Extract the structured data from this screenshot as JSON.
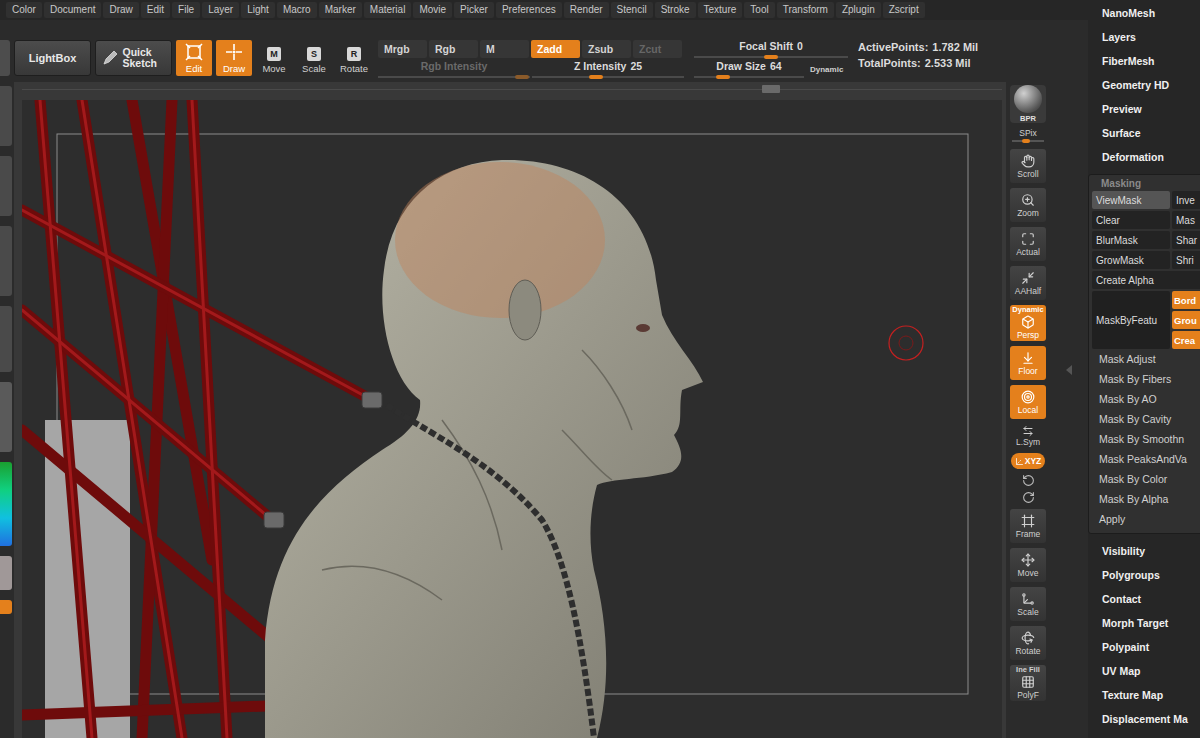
{
  "menu": [
    "Color",
    "Document",
    "Draw",
    "Edit",
    "File",
    "Layer",
    "Light",
    "Macro",
    "Marker",
    "Material",
    "Movie",
    "Picker",
    "Preferences",
    "Render",
    "Stencil",
    "Stroke",
    "Texture",
    "Tool",
    "Transform",
    "Zplugin",
    "Zscript"
  ],
  "toolbar": {
    "lightbox": "LightBox",
    "quickSketch": "Quick Sketch",
    "tools": [
      {
        "label": "Edit",
        "selected": true
      },
      {
        "label": "Draw",
        "selected": true
      },
      {
        "label": "Move",
        "key": "M",
        "selected": false
      },
      {
        "label": "Scale",
        "key": "S",
        "selected": false
      },
      {
        "label": "Rotate",
        "key": "R",
        "selected": false
      }
    ],
    "modes": [
      {
        "label": "Mrgb",
        "selected": false,
        "disabled": false
      },
      {
        "label": "Rgb",
        "selected": false,
        "disabled": false
      },
      {
        "label": "M",
        "selected": false,
        "disabled": false
      },
      {
        "label": "Zadd",
        "selected": true,
        "disabled": false
      },
      {
        "label": "Zsub",
        "selected": false,
        "disabled": false
      },
      {
        "label": "Zcut",
        "selected": false,
        "disabled": true
      }
    ],
    "intensity": [
      {
        "label": "Rgb Intensity",
        "level": 0.95,
        "disabled": true
      },
      {
        "label": "Z Intensity",
        "value": "25",
        "level": 0.42,
        "disabled": false
      }
    ],
    "focal": {
      "label": "Focal Shift",
      "value": "0",
      "level": 0.5,
      "disabled": false
    },
    "drawSize": {
      "label": "Draw Size",
      "value": "64",
      "level": 0.26,
      "disabled": false
    },
    "dynamic": "Dynamic",
    "stats": [
      {
        "label": "ActivePoints:",
        "value": "1.782 Mil"
      },
      {
        "label": "TotalPoints:",
        "value": "2.533 Mil"
      }
    ]
  },
  "canvas": {
    "scroll": 0.755
  },
  "shelf": [
    {
      "label": "BPR",
      "kind": "sphere",
      "selected": false
    },
    {
      "label": "SPix",
      "kind": "slider",
      "level": 0.45,
      "selected": false
    },
    {
      "label": "Scroll",
      "kind": "button",
      "selected": false
    },
    {
      "label": "Zoom",
      "kind": "button",
      "selected": false
    },
    {
      "label": "Actual",
      "kind": "button",
      "selected": false
    },
    {
      "label": "AAHalf",
      "kind": "button",
      "selected": false
    },
    {
      "label": "Persp",
      "top": "Dynamic",
      "kind": "button",
      "selected": true
    },
    {
      "label": "Floor",
      "kind": "button",
      "selected": true
    },
    {
      "label": "Local",
      "kind": "button",
      "selected": true
    },
    {
      "label": "L.Sym",
      "kind": "small",
      "selected": false
    },
    {
      "label": "XYZ",
      "kind": "pill",
      "selected": true
    },
    {
      "kind": "spin",
      "selected": false
    },
    {
      "label": "Frame",
      "kind": "button",
      "selected": false
    },
    {
      "label": "Move",
      "kind": "button",
      "selected": false
    },
    {
      "label": "Scale",
      "kind": "button",
      "selected": false
    },
    {
      "label": "Rotate",
      "kind": "button",
      "selected": false
    },
    {
      "label": "PolyF",
      "top": "Ine Fill",
      "kind": "button",
      "selected": false
    }
  ],
  "palette": {
    "top": [
      "NanoMesh",
      "Layers",
      "FiberMesh",
      "Geometry HD",
      "Preview",
      "Surface",
      "Deformation"
    ],
    "masking": {
      "title": "Masking",
      "expanded": true,
      "buttons": [
        {
          "label": "ViewMask",
          "selected": true
        },
        {
          "label": "Inve",
          "selected": false
        },
        {
          "label": "Clear",
          "selected": false
        },
        {
          "label": "Mas",
          "selected": false
        },
        {
          "label": "BlurMask",
          "selected": false
        },
        {
          "label": "Shar",
          "selected": false
        },
        {
          "label": "GrowMask",
          "selected": false
        },
        {
          "label": "Shri",
          "selected": false
        }
      ],
      "createAlpha": "Create Alpha",
      "feature": {
        "label": "MaskByFeatu",
        "options": [
          {
            "label": "Bord",
            "selected": true
          },
          {
            "label": "Grou",
            "selected": true
          },
          {
            "label": "Crea",
            "selected": true
          }
        ]
      },
      "items": [
        "Mask Adjust",
        "Mask By Fibers",
        "Mask By AO",
        "Mask By Cavity",
        "Mask By Smoothn",
        "Mask PeaksAndVa",
        "Mask By Color",
        "Mask By Alpha",
        "Apply"
      ]
    },
    "bottom": [
      "Visibility",
      "Polygroups",
      "Contact",
      "Morph Target",
      "Polypaint",
      "UV Map",
      "Texture Map",
      "Displacement Ma"
    ]
  }
}
